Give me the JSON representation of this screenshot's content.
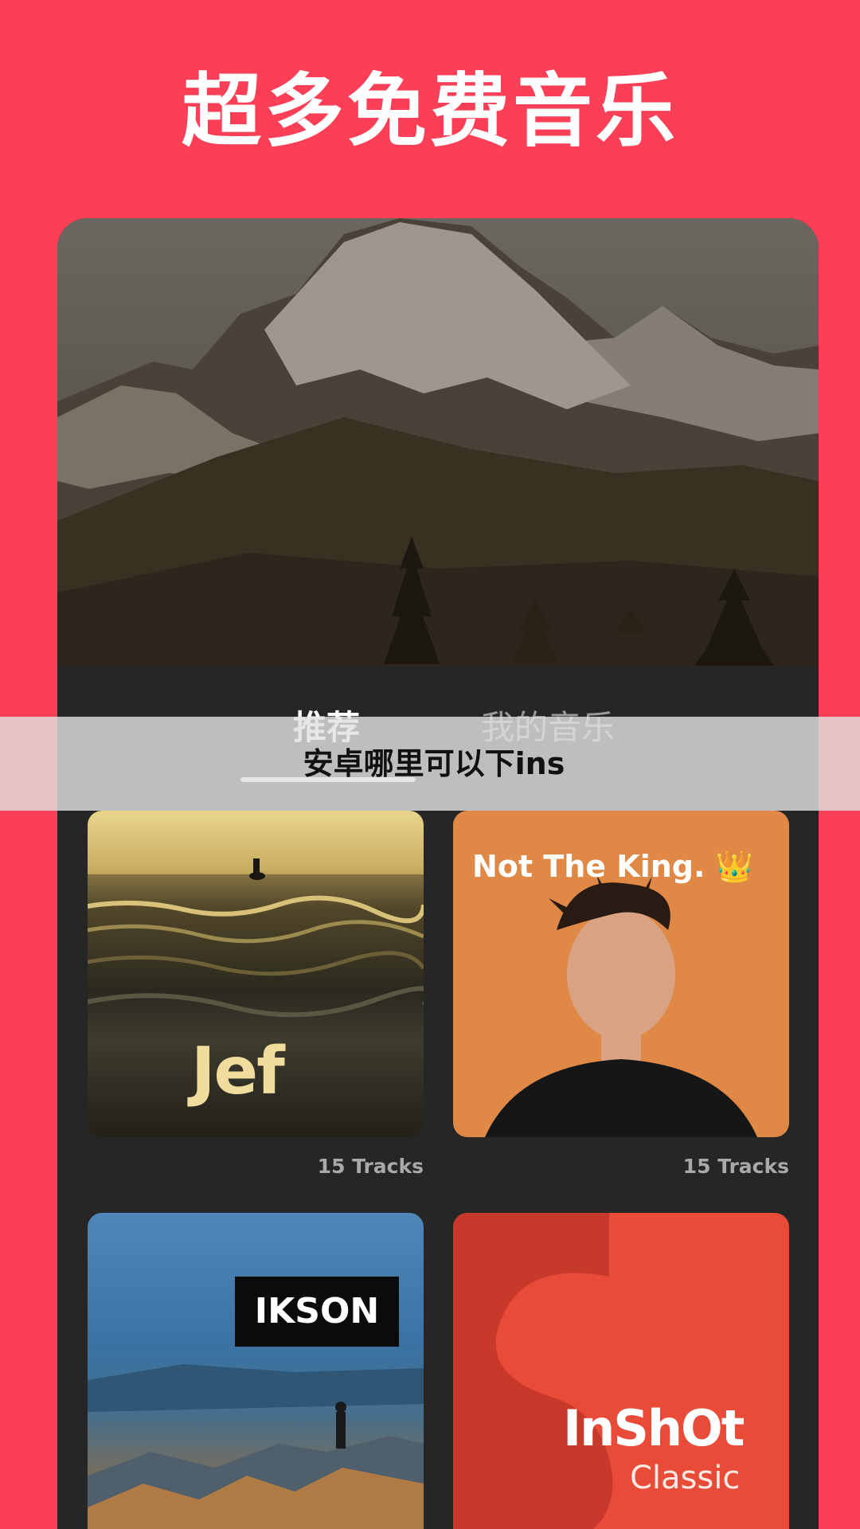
{
  "headline": "超多免费音乐",
  "tabs": {
    "recommend": "推荐",
    "my_music": "我的音乐"
  },
  "overlay": {
    "text": "安卓哪里可以下ins"
  },
  "playlists": [
    {
      "cover_text": "Jef",
      "tracks": "15 Tracks"
    },
    {
      "cover_text": "Not The King. 👑",
      "tracks": "15 Tracks"
    },
    {
      "cover_text": "IKSON",
      "tracks": ""
    },
    {
      "cover_text": "InShOt",
      "cover_subtext": "Classic",
      "tracks": ""
    }
  ],
  "colors": {
    "background": "#fb3f57",
    "panel": "#262626",
    "tab_active": "#ffffff",
    "tab_inactive": "#9a9a9a",
    "track_count": "#a9a9a9"
  }
}
